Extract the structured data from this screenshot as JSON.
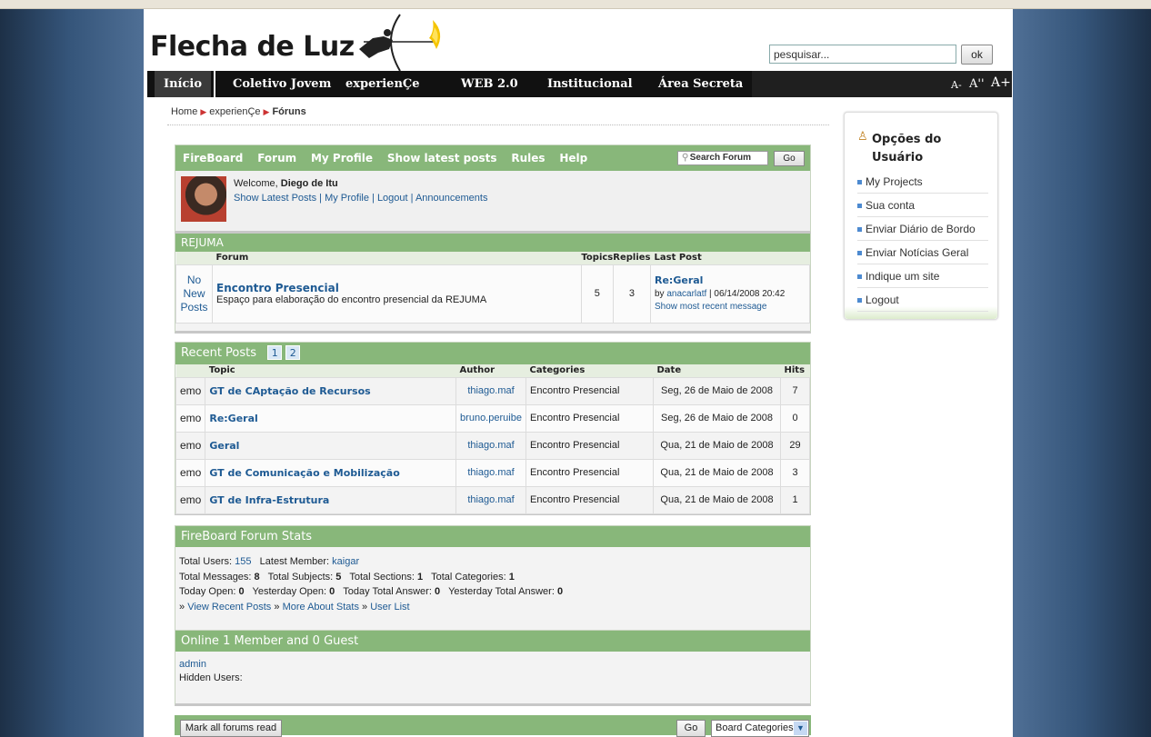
{
  "site": {
    "title": "Flecha de Luz",
    "search_placeholder": "pesquisar...",
    "search_button": "ok"
  },
  "nav": {
    "items": [
      "Início",
      "Coletivo Jovem",
      "experienÇe",
      "WEB 2.0",
      "Institucional",
      "Área Secreta"
    ],
    "font_small": "A-",
    "font_normal": "A''",
    "font_large": "A+"
  },
  "breadcrumb": {
    "home": "Home",
    "section": "experienÇe",
    "current": "Fóruns"
  },
  "fireboard": {
    "brand": "FireBoard",
    "links": [
      "Forum",
      "My Profile",
      "Show latest posts",
      "Rules",
      "Help"
    ],
    "search_placeholder": "Search Forum",
    "go": "Go",
    "welcome_prefix": "Welcome, ",
    "username": "Diego de Itu",
    "user_links": "Show Latest Posts | My Profile | Logout   | Announcements"
  },
  "category": {
    "name": "REJUMA",
    "headers": [
      "Forum",
      "Topics",
      "Replies",
      "Last Post"
    ],
    "row": {
      "status": "No New Posts",
      "forum_name": "Encontro Presencial",
      "description": "Espaço para elaboração do encontro presencial da REJUMA",
      "topics": "5",
      "replies": "3",
      "last_post_title": "Re:Geral",
      "last_post_by": "by",
      "last_post_author": "anacarlatf",
      "last_post_date": "| 06/14/2008 20:42",
      "show_recent": "Show most recent message"
    }
  },
  "recent_posts": {
    "title": "Recent Posts",
    "pages": [
      "1",
      "2"
    ],
    "headers": [
      "Topic",
      "Author",
      "Categories",
      "Date",
      "Hits"
    ],
    "rows": [
      {
        "prefix": "emo",
        "topic": "GT de CAptação de Recursos",
        "author": "thiago.maf",
        "category": "Encontro Presencial",
        "date": "Seg, 26 de Maio de 2008",
        "hits": "7"
      },
      {
        "prefix": "emo",
        "topic": "Re:Geral",
        "author": "bruno.peruibe",
        "category": "Encontro Presencial",
        "date": "Seg, 26 de Maio de 2008",
        "hits": "0"
      },
      {
        "prefix": "emo",
        "topic": "Geral",
        "author": "thiago.maf",
        "category": "Encontro Presencial",
        "date": "Qua, 21 de Maio de 2008",
        "hits": "29"
      },
      {
        "prefix": "emo",
        "topic": "GT de Comunicação e Mobilização",
        "author": "thiago.maf",
        "category": "Encontro Presencial",
        "date": "Qua, 21 de Maio de 2008",
        "hits": "3"
      },
      {
        "prefix": "emo",
        "topic": "GT de Infra-Estrutura",
        "author": "thiago.maf",
        "category": "Encontro Presencial",
        "date": "Qua, 21 de Maio de 2008",
        "hits": "1"
      }
    ]
  },
  "stats": {
    "title": "FireBoard Forum Stats",
    "total_users_label": "Total Users:",
    "total_users": "155",
    "latest_member_label": "Latest Member:",
    "latest_member": "kaigar",
    "total_messages_label": "Total Messages:",
    "total_messages": "8",
    "total_subjects_label": "Total Subjects:",
    "total_subjects": "5",
    "total_sections_label": "Total Sections:",
    "total_sections": "1",
    "total_categories_label": "Total Categories:",
    "total_categories": "1",
    "today_open_label": "Today Open:",
    "today_open": "0",
    "yesterday_open_label": "Yesterday Open:",
    "yesterday_open": "0",
    "today_answer_label": "Today Total Answer:",
    "today_answer": "0",
    "yesterday_answer_label": "Yesterday Total Answer:",
    "yesterday_answer": "0",
    "link_recent": "View Recent Posts",
    "link_more": "More About Stats",
    "link_userlist": "User List"
  },
  "online": {
    "title": "Online 1 Member and 0 Guest",
    "member": "admin",
    "hidden": "Hidden Users:"
  },
  "footer_bar": {
    "mark_read": "Mark all forums read",
    "go": "Go",
    "select_value": "Board Categories"
  },
  "sidebar": {
    "title": "Opções do Usuário",
    "items": [
      "My Projects",
      "Sua conta",
      "Enviar Diário de Bordo",
      "Enviar Notícias Geral",
      "Indique um site",
      "Logout"
    ]
  },
  "colors": {
    "accent_green": "#88b77a",
    "link_blue": "#1e5a93",
    "nav_black": "#1f1f1f"
  }
}
